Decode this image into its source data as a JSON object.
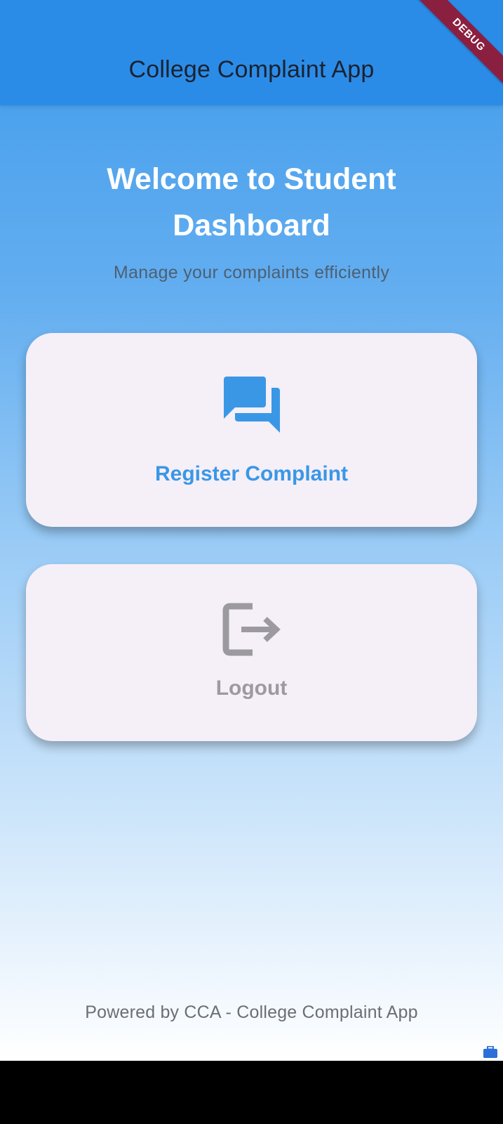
{
  "app_bar": {
    "title": "College Complaint App",
    "debug_label": "DEBUG",
    "background_color": "#2b8ce8",
    "debug_color": "#8b1f3f"
  },
  "header": {
    "title": "Welcome to Student Dashboard",
    "subtitle": "Manage your complaints efficiently"
  },
  "actions": [
    {
      "label": "Register Complaint",
      "icon": "forum-icon",
      "color": "#3a97e6"
    },
    {
      "label": "Logout",
      "icon": "logout-icon",
      "color": "#9c9a9e"
    }
  ],
  "footer": {
    "text": "Powered by CCA - College Complaint App"
  },
  "system": {
    "corner_icon": "briefcase-icon"
  }
}
